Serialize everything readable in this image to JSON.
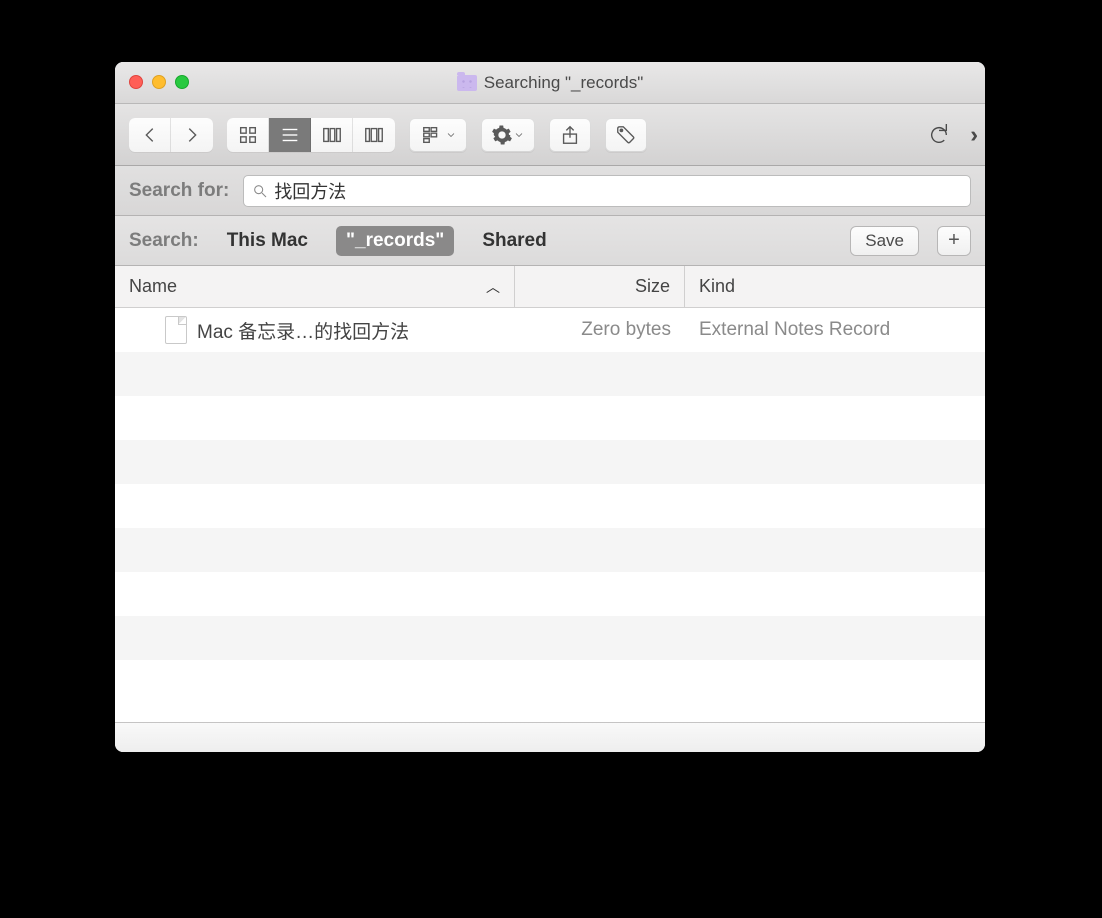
{
  "window": {
    "title": "Searching \"_records\""
  },
  "searchfor": {
    "label": "Search for:",
    "value": "找回方法"
  },
  "scope": {
    "label": "Search:",
    "items": [
      {
        "label": "This Mac",
        "selected": false
      },
      {
        "label": "\"_records\"",
        "selected": true
      },
      {
        "label": "Shared",
        "selected": false
      }
    ],
    "save_label": "Save",
    "plus_label": "+"
  },
  "columns": {
    "name": "Name",
    "size": "Size",
    "kind": "Kind",
    "sort_indicator": "︿"
  },
  "rows": [
    {
      "name": "Mac 备忘录…的找回方法",
      "size": "Zero bytes",
      "kind": "External Notes Record"
    }
  ]
}
